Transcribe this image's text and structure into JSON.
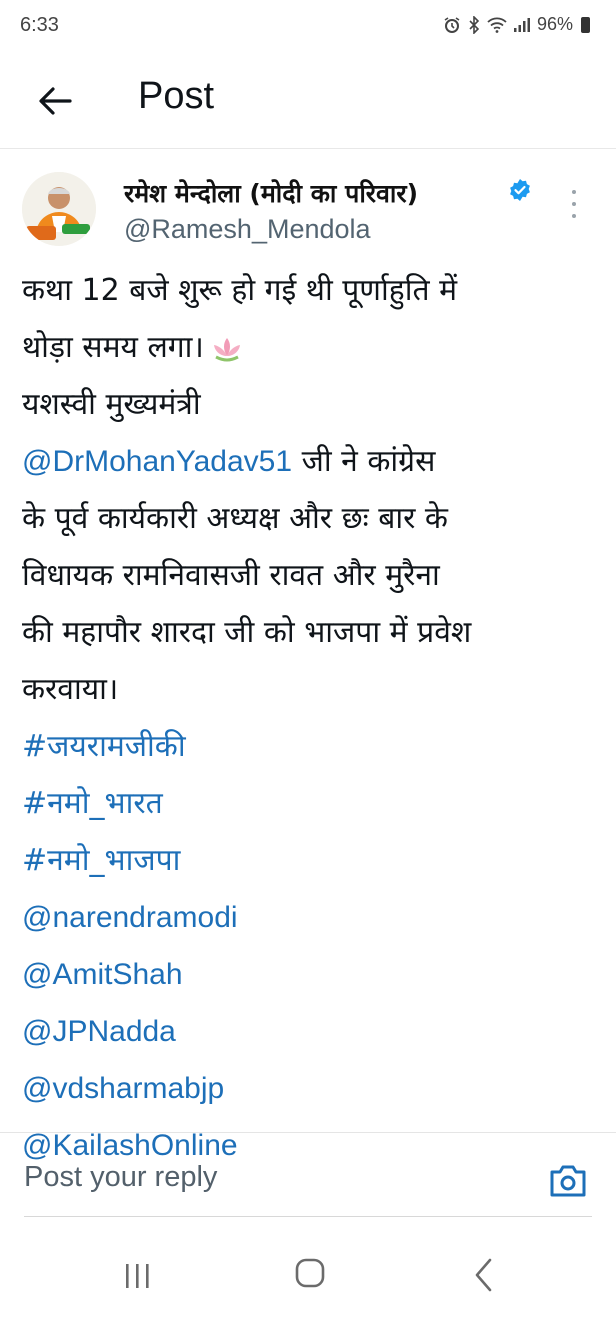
{
  "status_bar": {
    "time": "6:33",
    "battery": "96%",
    "icons": [
      "alarm-icon",
      "bluetooth-icon",
      "wifi-icon",
      "signal-icon",
      "battery-icon"
    ]
  },
  "header": {
    "title": "Post",
    "back_icon": "arrow-left-icon"
  },
  "post": {
    "display_name": "रमेश मेन्दोला (मोदी का परिवार)",
    "handle": "@Ramesh_Mendola",
    "verified": true,
    "text": {
      "line1": "कथा 12 बजे शुरू हो गई थी पूर्णाहुति में",
      "line2": "थोड़ा समय लगा।",
      "line2_emoji": "lotus-icon",
      "line3": "यशस्वी मुख्यमंत्री",
      "mention_cm": "@DrMohanYadav51",
      "line4_rest": " जी ने कांग्रेस",
      "line5": "के पूर्व कार्यकारी अध्यक्ष और छः बार के",
      "line6": "विधायक रामनिवासजी रावत और मुरैना",
      "line7": "की महापौर शारदा जी को भाजपा में प्रवेश",
      "line8": "करवाया।"
    },
    "hashtags": [
      "#जयरामजीकी",
      "#नमो_भारत",
      "#नमो_भाजपा"
    ],
    "mentions": [
      "@narendramodi",
      "@AmitShah",
      "@JPNadda",
      "@vdsharmabjp",
      "@KailashOnline"
    ]
  },
  "reply": {
    "placeholder": "Post your reply",
    "camera_icon": "camera-icon"
  },
  "nav_bar": {
    "icons": [
      "recents-icon",
      "home-icon",
      "back-icon"
    ]
  },
  "colors": {
    "link": "#1d6fb8",
    "verified": "#1d9bf0",
    "text": "#0f1419",
    "secondary": "#536471"
  }
}
